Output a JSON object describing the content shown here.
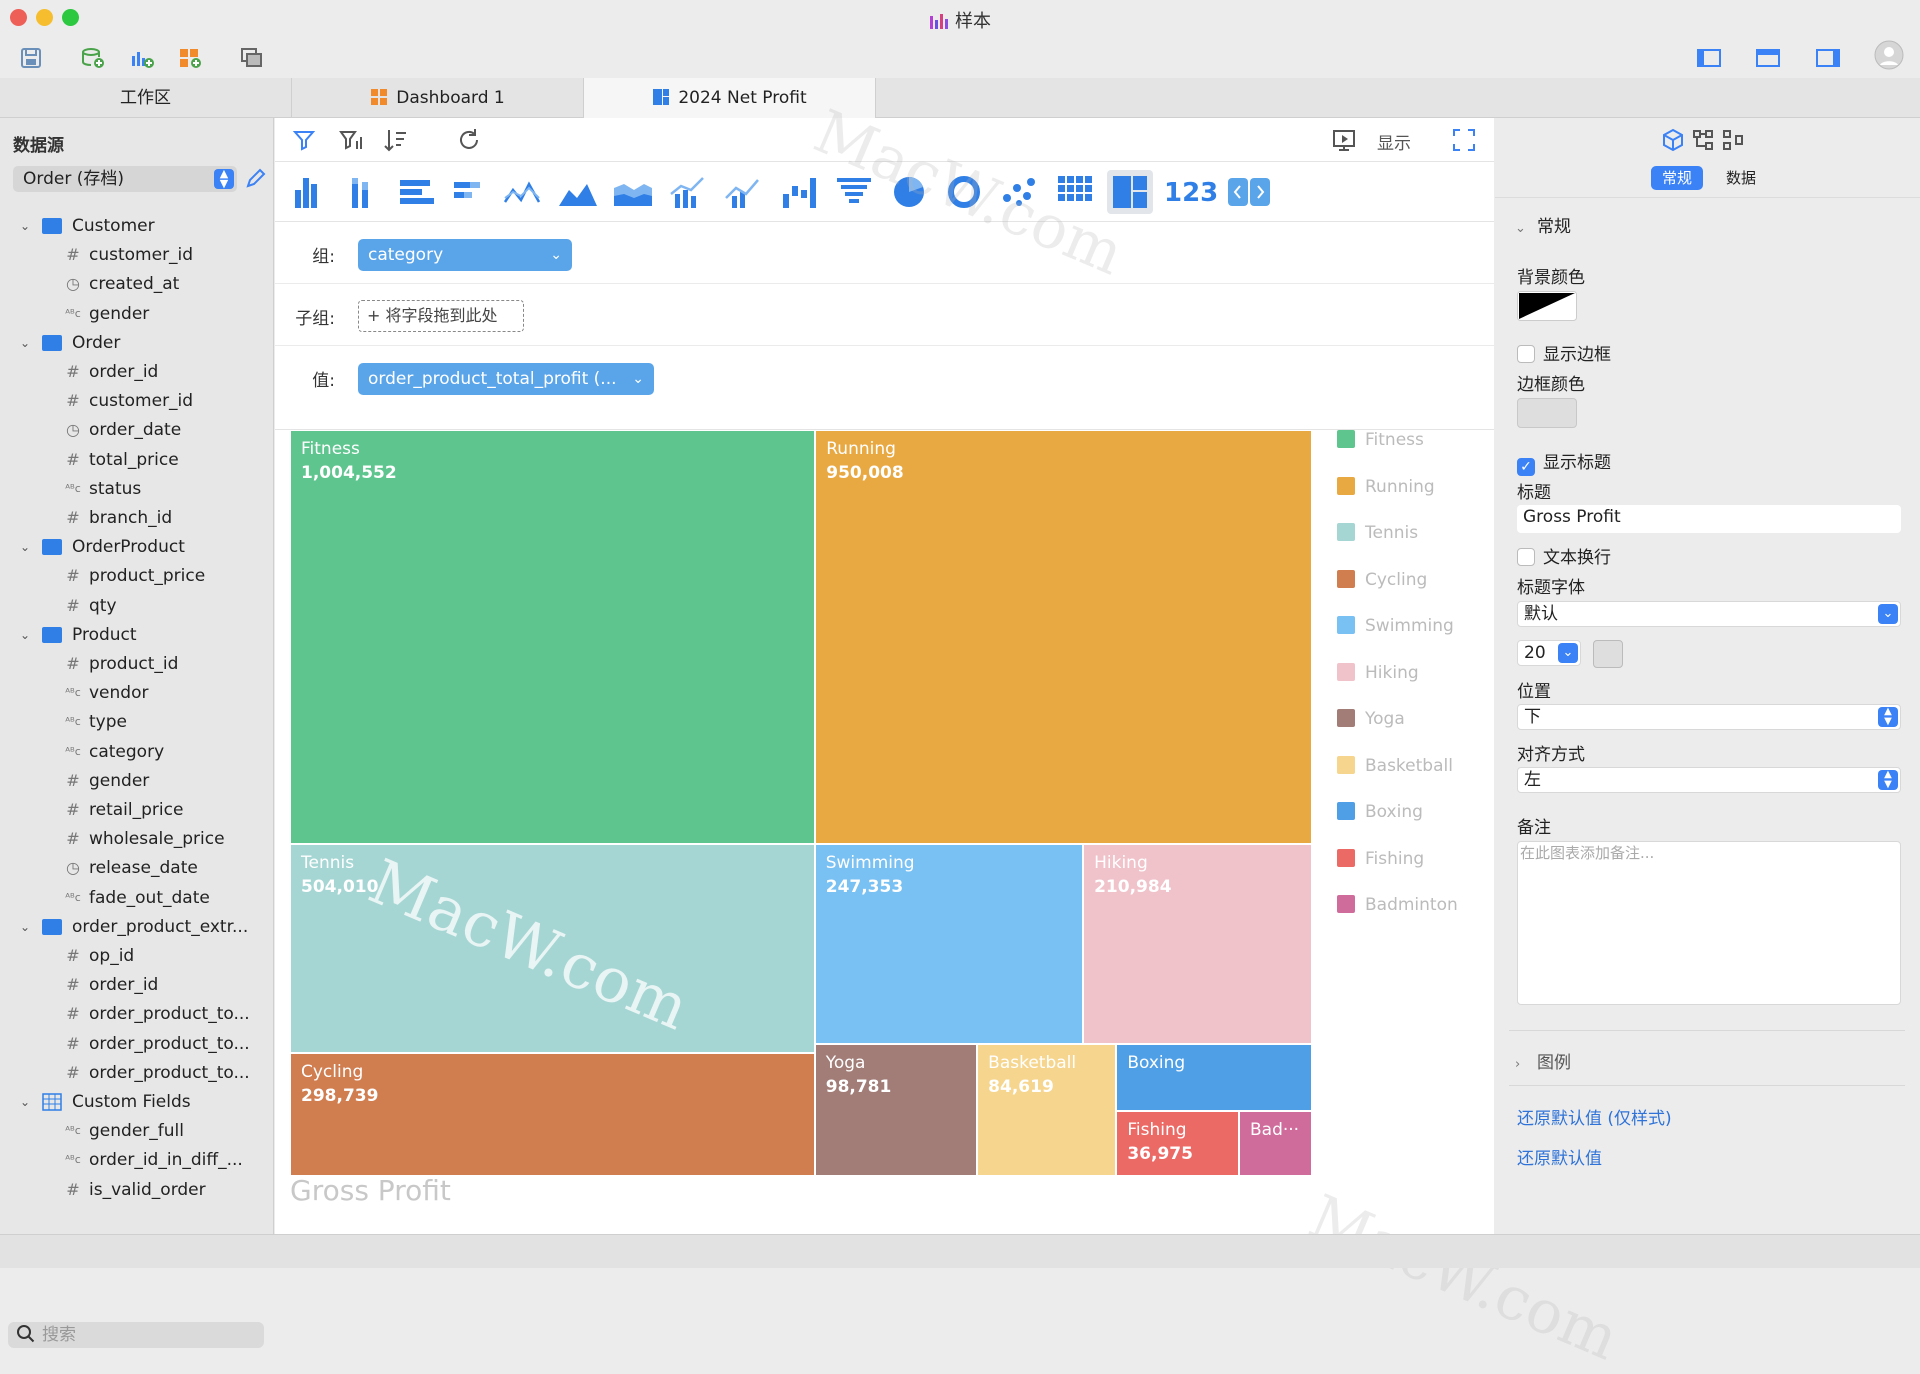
{
  "window": {
    "title": "样本"
  },
  "tabs": [
    {
      "label": "工作区"
    },
    {
      "label": "Dashboard 1"
    },
    {
      "label": "2024 Net Profit"
    }
  ],
  "sidebar": {
    "title": "数据源",
    "datasource": "Order (存档)",
    "search_placeholder": "搜索",
    "tree": [
      {
        "label": "Customer",
        "kind": "table"
      },
      {
        "label": "customer_id",
        "kind": "number"
      },
      {
        "label": "created_at",
        "kind": "date"
      },
      {
        "label": "gender",
        "kind": "text"
      },
      {
        "label": "Order",
        "kind": "table"
      },
      {
        "label": "order_id",
        "kind": "number"
      },
      {
        "label": "customer_id",
        "kind": "number"
      },
      {
        "label": "order_date",
        "kind": "date"
      },
      {
        "label": "total_price",
        "kind": "number"
      },
      {
        "label": "status",
        "kind": "text"
      },
      {
        "label": "branch_id",
        "kind": "number"
      },
      {
        "label": "OrderProduct",
        "kind": "table"
      },
      {
        "label": "product_price",
        "kind": "number"
      },
      {
        "label": "qty",
        "kind": "number"
      },
      {
        "label": "Product",
        "kind": "table"
      },
      {
        "label": "product_id",
        "kind": "number"
      },
      {
        "label": "vendor",
        "kind": "text"
      },
      {
        "label": "type",
        "kind": "text"
      },
      {
        "label": "category",
        "kind": "text"
      },
      {
        "label": "gender",
        "kind": "number"
      },
      {
        "label": "retail_price",
        "kind": "number"
      },
      {
        "label": "wholesale_price",
        "kind": "number"
      },
      {
        "label": "release_date",
        "kind": "date"
      },
      {
        "label": "fade_out_date",
        "kind": "text"
      },
      {
        "label": "order_product_extr...",
        "kind": "table"
      },
      {
        "label": "op_id",
        "kind": "number"
      },
      {
        "label": "order_id",
        "kind": "number"
      },
      {
        "label": "order_product_to...",
        "kind": "number"
      },
      {
        "label": "order_product_to...",
        "kind": "number"
      },
      {
        "label": "order_product_to...",
        "kind": "number"
      },
      {
        "label": "Custom Fields",
        "kind": "custom"
      },
      {
        "label": "gender_full",
        "kind": "text"
      },
      {
        "label": "order_id_in_diff_...",
        "kind": "text"
      },
      {
        "label": "is_valid_order",
        "kind": "number"
      }
    ]
  },
  "editor": {
    "show_label": "显示",
    "group_label": "组:",
    "group_value": "category",
    "subgroup_label": "子组:",
    "subgroup_placeholder": "将字段拖到此处",
    "value_label": "值:",
    "value_value": "order_product_total_profit (..."
  },
  "chart_data": {
    "type": "treemap",
    "title": "Gross Profit",
    "title_position": "bottom-left",
    "legend_position": "right",
    "series": [
      {
        "name": "Fitness",
        "value": 1004552,
        "label": "1,004,552",
        "color": "#5ec58f"
      },
      {
        "name": "Running",
        "value": 950008,
        "label": "950,008",
        "color": "#e9a942"
      },
      {
        "name": "Tennis",
        "value": 504010,
        "label": "504,010",
        "color": "#a6d6d3"
      },
      {
        "name": "Cycling",
        "value": 298739,
        "label": "298,739",
        "color": "#d07d50"
      },
      {
        "name": "Swimming",
        "value": 247353,
        "label": "247,353",
        "color": "#79c0f3"
      },
      {
        "name": "Hiking",
        "value": 210984,
        "label": "210,984",
        "color": "#f0c2ca"
      },
      {
        "name": "Yoga",
        "value": 98781,
        "label": "98,781",
        "color": "#a27c77"
      },
      {
        "name": "Basketball",
        "value": 84619,
        "label": "84,619",
        "color": "#f6d58e"
      },
      {
        "name": "Boxing",
        "value": null,
        "label": "",
        "color": "#4f9fe6"
      },
      {
        "name": "Fishing",
        "value": 36975,
        "label": "36,975",
        "color": "#ec6a66"
      },
      {
        "name": "Badminton",
        "value": null,
        "label": "",
        "color": "#d06c9c",
        "display_name": "Bad···"
      }
    ]
  },
  "panel": {
    "tabs": [
      "常规",
      "数据"
    ],
    "section_general": "常规",
    "bg_color_label": "背景颜色",
    "show_border_label": "显示边框",
    "border_color_label": "边框颜色",
    "show_title_label": "显示标题",
    "title_label": "标题",
    "title_value": "Gross Profit",
    "wrap_label": "文本换行",
    "title_font_label": "标题字体",
    "title_font_value": "默认",
    "font_size_value": "20",
    "position_label": "位置",
    "position_value": "下",
    "align_label": "对齐方式",
    "align_value": "左",
    "notes_label": "备注",
    "notes_placeholder": "在此图表添加备注...",
    "section_legend": "图例",
    "reset_style": "还原默认值 (仅样式)",
    "reset_all": "还原默认值"
  },
  "watermark": "MacW.com",
  "colors": {
    "accent": "#3b82f6",
    "pill": "#5aa5ea"
  }
}
